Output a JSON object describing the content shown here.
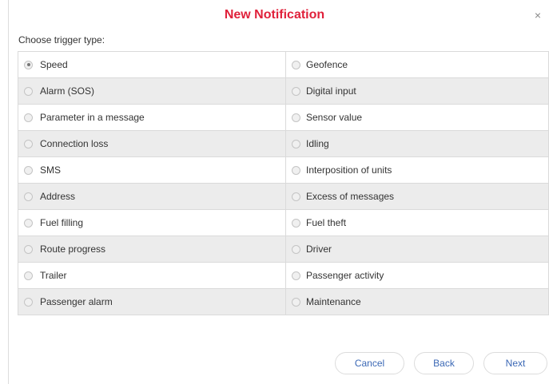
{
  "dialog": {
    "title": "New Notification",
    "close_symbol": "×",
    "prompt": "Choose trigger type:"
  },
  "triggers": {
    "left": [
      {
        "label": "Speed",
        "checked": true
      },
      {
        "label": "Alarm (SOS)",
        "checked": false
      },
      {
        "label": "Parameter in a message",
        "checked": false
      },
      {
        "label": "Connection loss",
        "checked": false
      },
      {
        "label": "SMS",
        "checked": false
      },
      {
        "label": "Address",
        "checked": false
      },
      {
        "label": "Fuel filling",
        "checked": false
      },
      {
        "label": "Route progress",
        "checked": false
      },
      {
        "label": "Trailer",
        "checked": false
      },
      {
        "label": "Passenger alarm",
        "checked": false
      }
    ],
    "right": [
      {
        "label": "Geofence",
        "checked": false
      },
      {
        "label": "Digital input",
        "checked": false
      },
      {
        "label": "Sensor value",
        "checked": false
      },
      {
        "label": "Idling",
        "checked": false
      },
      {
        "label": "Interposition of units",
        "checked": false
      },
      {
        "label": "Excess of messages",
        "checked": false
      },
      {
        "label": "Fuel theft",
        "checked": false
      },
      {
        "label": "Driver",
        "checked": false
      },
      {
        "label": "Passenger activity",
        "checked": false
      },
      {
        "label": "Maintenance",
        "checked": false
      }
    ]
  },
  "buttons": {
    "cancel": "Cancel",
    "back": "Back",
    "next": "Next"
  },
  "colors": {
    "title": "#e0213b",
    "button_text": "#3b68b5",
    "row_alt": "#ececec"
  }
}
